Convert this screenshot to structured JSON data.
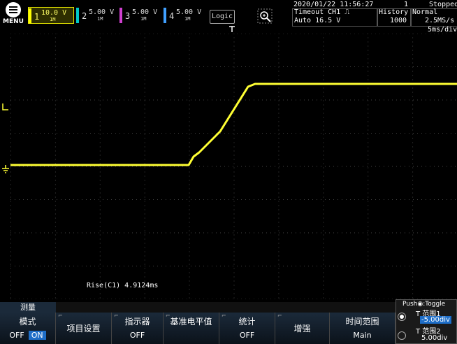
{
  "top": {
    "menu_label": "MENU",
    "channels": [
      {
        "num": "1",
        "val": "10.0 V",
        "coupling": "1M",
        "color": "#ffff00"
      },
      {
        "num": "2",
        "val": "5.00 V",
        "coupling": "1M",
        "color": "#00c8c8"
      },
      {
        "num": "3",
        "val": "5.00 V",
        "coupling": "1M",
        "color": "#d040d0"
      },
      {
        "num": "4",
        "val": "5.00 V",
        "coupling": "1M",
        "color": "#40a0ff"
      }
    ],
    "logic_label": "Logic",
    "datetime": "2020/01/22 11:56:27",
    "count": "1",
    "state": "Stopped",
    "trigger_line1": "Timeout CH1 ⎍",
    "trigger_line2": "Auto 16.5 V",
    "history_label": "History",
    "history_value": "1000",
    "acq_mode": "Normal",
    "sample_rate": "2.5MS/s",
    "timebase": "5ms/div"
  },
  "screen": {
    "trace_color": "#ffff33",
    "measurement": "Rise(C1)  4.9124ms"
  },
  "softkeys": {
    "measure_tab": "测量",
    "mode_label": "模式",
    "mode_off": "OFF",
    "mode_on": "ON",
    "item_setup": "项目设置",
    "indicator": "指示器",
    "indicator_value": "OFF",
    "ref_level": "基准电平值",
    "stats": "统计",
    "stats_value": "OFF",
    "gain": "增强",
    "time_range": "时间范围",
    "time_range_value": "Main"
  },
  "right_panel": {
    "push_toggle": "Push◉:Toggle",
    "range1_label": "T 范围1",
    "range1_value": "-5.00div",
    "range2_label": "T 范围2",
    "range2_value": "5.00div"
  }
}
